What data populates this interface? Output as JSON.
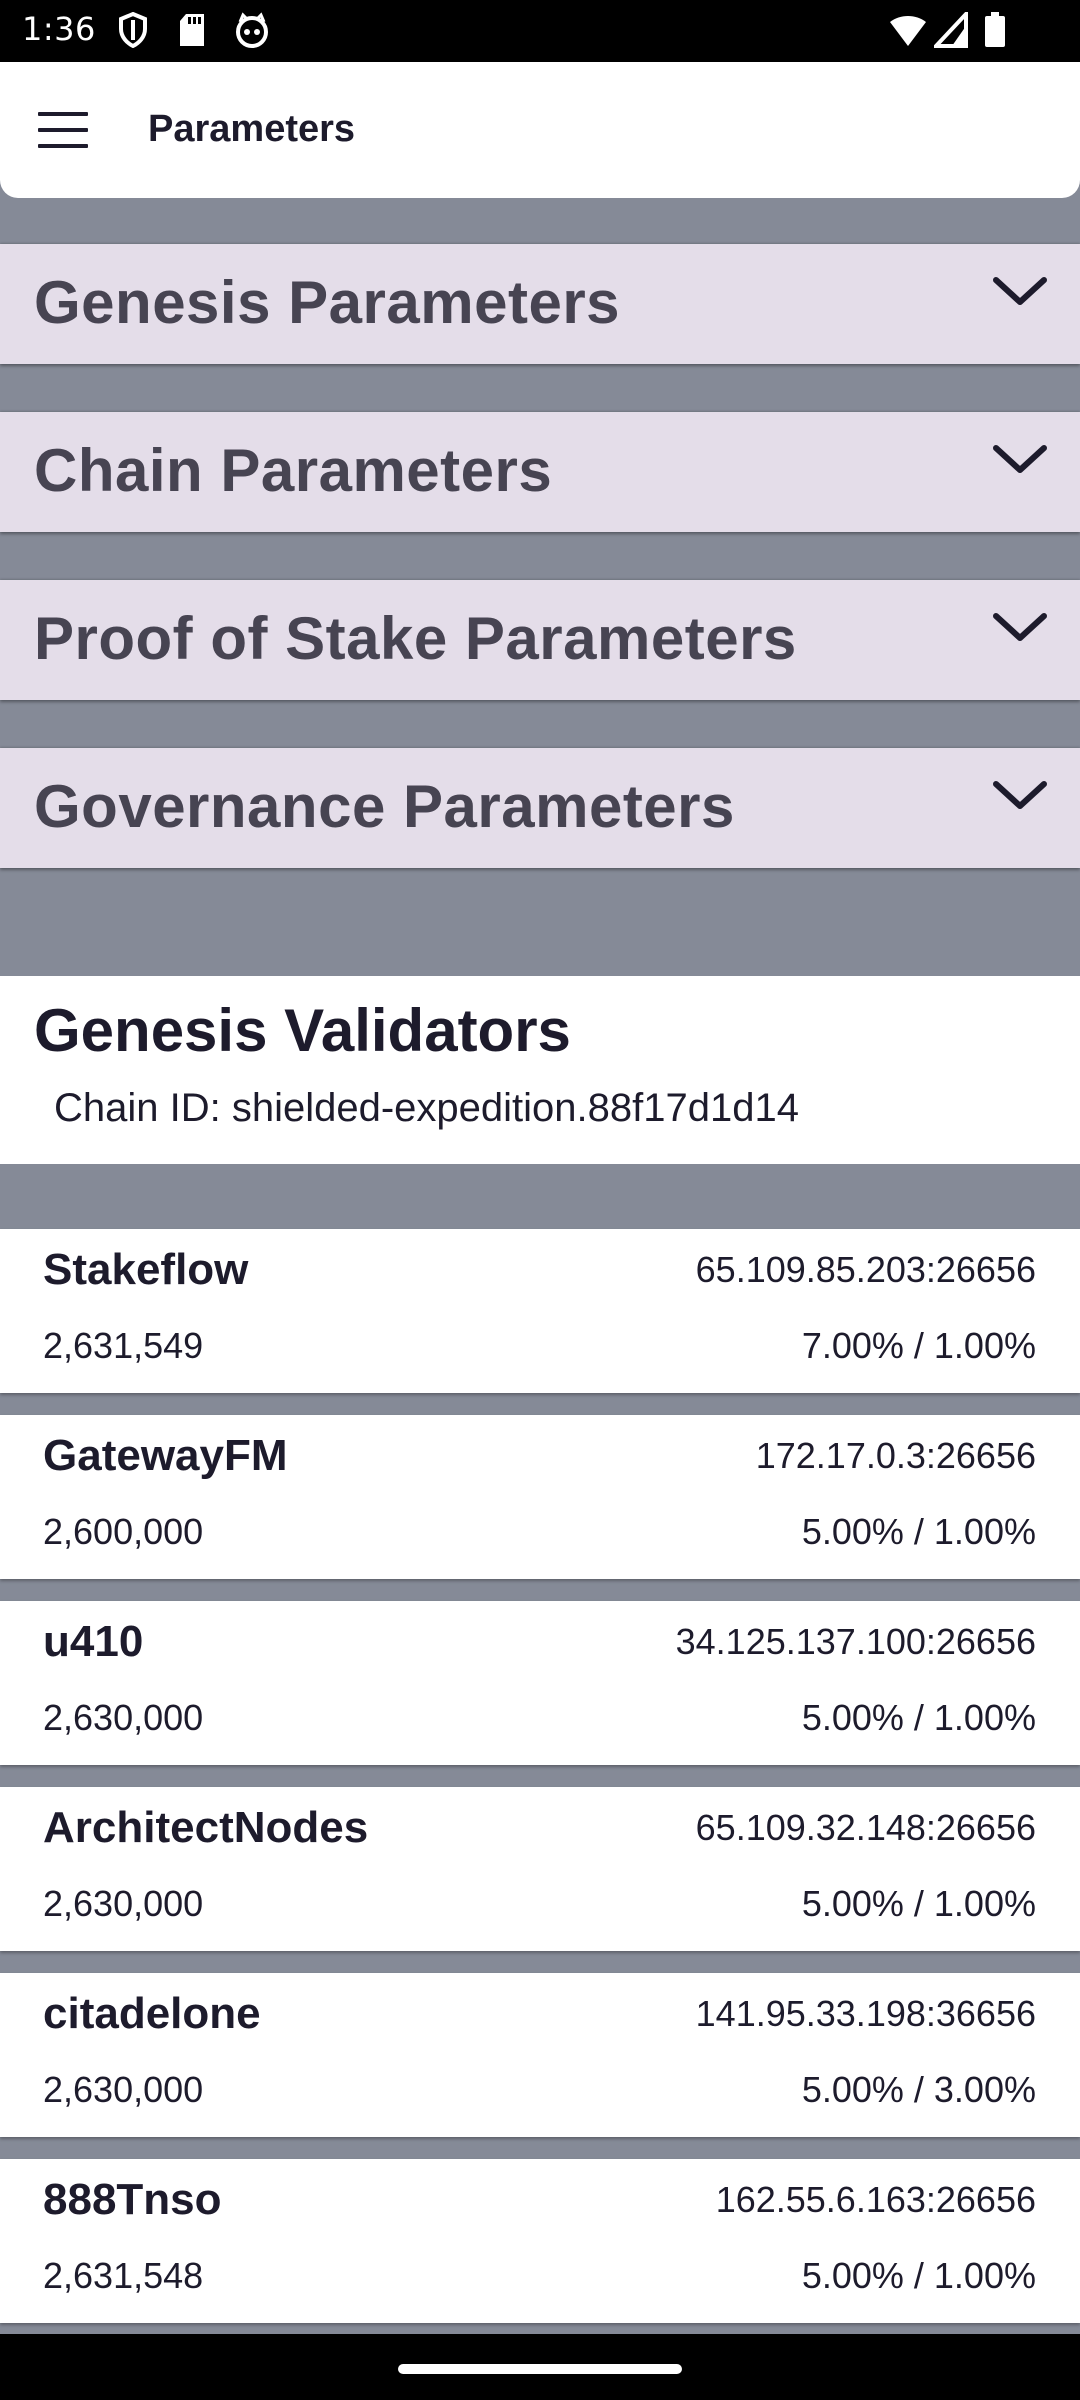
{
  "status_bar": {
    "time": "1:36",
    "icons_left": [
      "shield-icon",
      "sd-card-icon",
      "cat-face-icon"
    ],
    "icons_right": [
      "wifi-icon",
      "signal-icon",
      "battery-icon"
    ]
  },
  "app_bar": {
    "title": "Parameters",
    "menu_icon": "hamburger-menu-icon"
  },
  "sections": [
    {
      "title": "Genesis Parameters",
      "expanded": false
    },
    {
      "title": "Chain Parameters",
      "expanded": false
    },
    {
      "title": "Proof of Stake Parameters",
      "expanded": false
    },
    {
      "title": "Governance Parameters",
      "expanded": false
    }
  ],
  "validators": {
    "title": "Genesis Validators",
    "chain_id": "Chain ID: shielded-expedition.88f17d1d14",
    "items": [
      {
        "name": "Stakeflow",
        "address": "65.109.85.203:26656",
        "stake": "2,631,549",
        "rates": "7.00% / 1.00%"
      },
      {
        "name": "GatewayFM",
        "address": "172.17.0.3:26656",
        "stake": "2,600,000",
        "rates": "5.00% / 1.00%"
      },
      {
        "name": "u410",
        "address": "34.125.137.100:26656",
        "stake": "2,630,000",
        "rates": "5.00% / 1.00%"
      },
      {
        "name": "ArchitectNodes",
        "address": "65.109.32.148:26656",
        "stake": "2,630,000",
        "rates": "5.00% / 1.00%"
      },
      {
        "name": "citadelone",
        "address": "141.95.33.198:36656",
        "stake": "2,630,000",
        "rates": "5.00% / 3.00%"
      },
      {
        "name": "888Tnso",
        "address": "162.55.6.163:26656",
        "stake": "2,631,548",
        "rates": "5.00% / 1.00%"
      }
    ]
  },
  "colors": {
    "background": "#858a97",
    "section_header": "#e4dde9",
    "section_text": "#474452",
    "card": "#ffffff",
    "text": "#1d1b2c"
  }
}
